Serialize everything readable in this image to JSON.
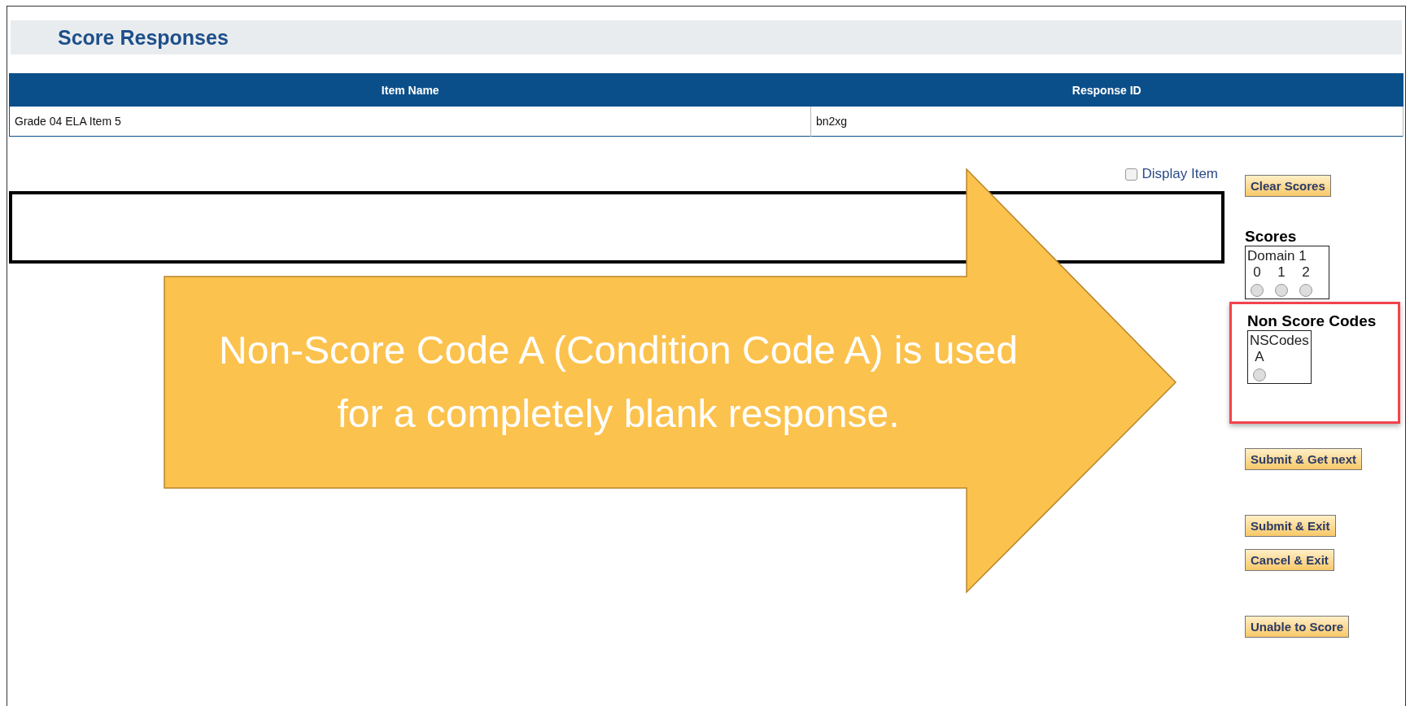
{
  "page": {
    "title": "Score Responses"
  },
  "table": {
    "columns": [
      "Item Name",
      "Response ID"
    ],
    "rows": [
      [
        "Grade 04 ELA Item 5",
        "bn2xg"
      ]
    ]
  },
  "display_item": {
    "label": "Display Item",
    "checked": false
  },
  "clear_button": "Clear Scores",
  "scores": {
    "title": "Scores",
    "group": "Domain 1",
    "options": [
      {
        "label": "0",
        "selected": false
      },
      {
        "label": "1",
        "selected": false
      },
      {
        "label": "2",
        "selected": false
      }
    ]
  },
  "non_score_codes": {
    "title": "Non Score Codes",
    "group": "NSCodes",
    "highlighted": true,
    "options": [
      {
        "label": "A",
        "selected": false
      }
    ]
  },
  "actions": [
    "Submit & Get next",
    "Submit & Exit",
    "Cancel & Exit",
    "Unable to Score"
  ],
  "callout": {
    "text": "Non-Score Code A (Condition Code A) is used for a completely blank response."
  }
}
